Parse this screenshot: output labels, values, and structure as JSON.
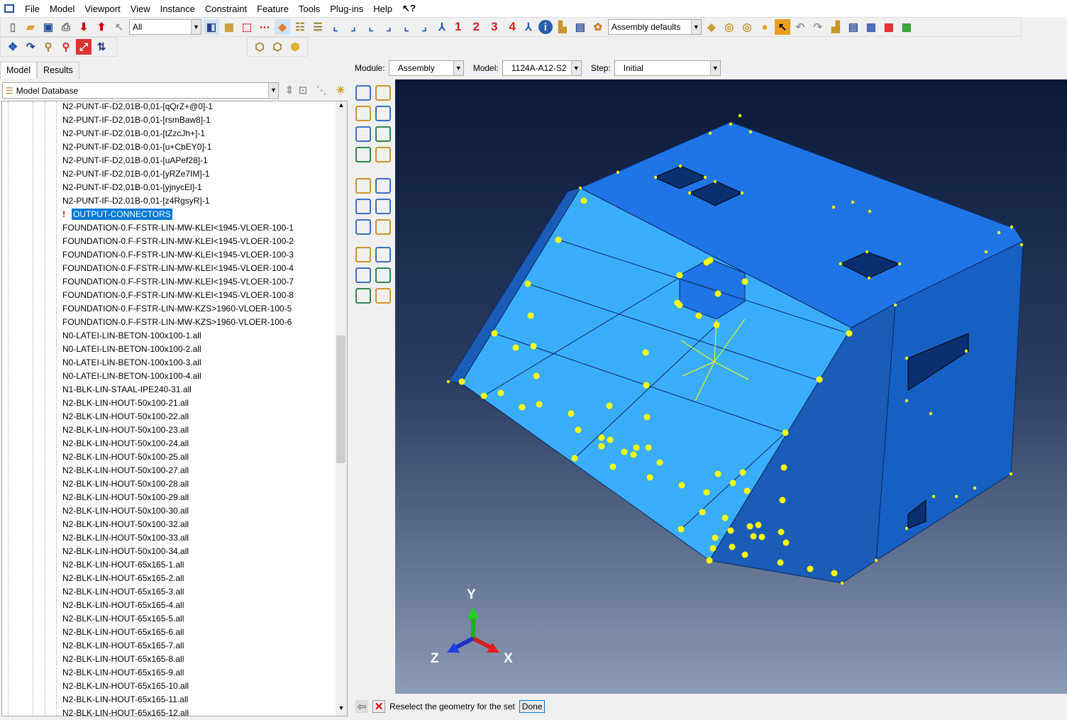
{
  "menu": [
    "File",
    "Model",
    "Viewport",
    "View",
    "Instance",
    "Constraint",
    "Feature",
    "Tools",
    "Plug-ins",
    "Help"
  ],
  "help_icon": "whats-this-icon",
  "toolbar": {
    "selection_filter": "All",
    "view_numbers": [
      "1",
      "2",
      "3",
      "4"
    ],
    "render_style": "Assembly defaults"
  },
  "tabs": [
    "Model",
    "Results"
  ],
  "tree_root": "Model Database",
  "context": {
    "module_label": "Module:",
    "module": "Assembly",
    "model_label": "Model:",
    "model": "1124A-A12-S2",
    "step_label": "Step:",
    "step": "Initial"
  },
  "tree_items": [
    "N2-PUNT-IF-D2,01B-0,01-[qQrZ+@0]-1",
    "N2-PUNT-IF-D2,01B-0,01-[rsmBaw8]-1",
    "N2-PUNT-IF-D2,01B-0,01-[tZzcJh+]-1",
    "N2-PUNT-IF-D2,01B-0,01-[u+CbEY0]-1",
    "N2-PUNT-IF-D2,01B-0,01-[uAPef28]-1",
    "N2-PUNT-IF-D2,01B-0,01-[yRZe7IM]-1",
    "N2-PUNT-IF-D2,01B-0,01-[yjnycEl]-1",
    "N2-PUNT-IF-D2,01B-0,01-[z4RgsyR]-1",
    "OUTPUT-CONNECTORS",
    "FOUNDATION-0.F-FSTR-LIN-MW-KLEI<1945-VLOER-100-1",
    "FOUNDATION-0.F-FSTR-LIN-MW-KLEI<1945-VLOER-100-2",
    "FOUNDATION-0.F-FSTR-LIN-MW-KLEI<1945-VLOER-100-3",
    "FOUNDATION-0.F-FSTR-LIN-MW-KLEI<1945-VLOER-100-4",
    "FOUNDATION-0.F-FSTR-LIN-MW-KLEI<1945-VLOER-100-7",
    "FOUNDATION-0.F-FSTR-LIN-MW-KLEI<1945-VLOER-100-8",
    "FOUNDATION-0.F-FSTR-LIN-MW-KZS>1960-VLOER-100-5",
    "FOUNDATION-0.F-FSTR-LIN-MW-KZS>1960-VLOER-100-6",
    "N0-LATEI-LIN-BETON-100x100-1.all",
    "N0-LATEI-LIN-BETON-100x100-2.all",
    "N0-LATEI-LIN-BETON-100x100-3.all",
    "N0-LATEI-LIN-BETON-100x100-4.all",
    "N1-BLK-LIN-STAAL-IPE240-31.all",
    "N2-BLK-LIN-HOUT-50x100-21.all",
    "N2-BLK-LIN-HOUT-50x100-22.all",
    "N2-BLK-LIN-HOUT-50x100-23.all",
    "N2-BLK-LIN-HOUT-50x100-24.all",
    "N2-BLK-LIN-HOUT-50x100-25.all",
    "N2-BLK-LIN-HOUT-50x100-27.all",
    "N2-BLK-LIN-HOUT-50x100-28.all",
    "N2-BLK-LIN-HOUT-50x100-29.all",
    "N2-BLK-LIN-HOUT-50x100-30.all",
    "N2-BLK-LIN-HOUT-50x100-32.all",
    "N2-BLK-LIN-HOUT-50x100-33.all",
    "N2-BLK-LIN-HOUT-50x100-34.all",
    "N2-BLK-LIN-HOUT-65x165-1.all",
    "N2-BLK-LIN-HOUT-65x165-2.all",
    "N2-BLK-LIN-HOUT-65x165-3.all",
    "N2-BLK-LIN-HOUT-65x165-4.all",
    "N2-BLK-LIN-HOUT-65x165-5.all",
    "N2-BLK-LIN-HOUT-65x165-6.all",
    "N2-BLK-LIN-HOUT-65x165-7.all",
    "N2-BLK-LIN-HOUT-65x165-8.all",
    "N2-BLK-LIN-HOUT-65x165-9.all",
    "N2-BLK-LIN-HOUT-65x165-10.all",
    "N2-BLK-LIN-HOUT-65x165-11.all",
    "N2-BLK-LIN-HOUT-65x165-12.all"
  ],
  "selected_item": "OUTPUT-CONNECTORS",
  "triad": {
    "x": "X",
    "y": "Y",
    "z": "Z"
  },
  "prompt": {
    "text": "Reselect the geometry for the set",
    "done": "Done"
  },
  "colors": {
    "roof": "#1f74e6",
    "slope": "#3aaefc",
    "front": "#1a5cb8",
    "side": "#1660c4",
    "points": "#ffff00",
    "selection": "#0078d7"
  }
}
